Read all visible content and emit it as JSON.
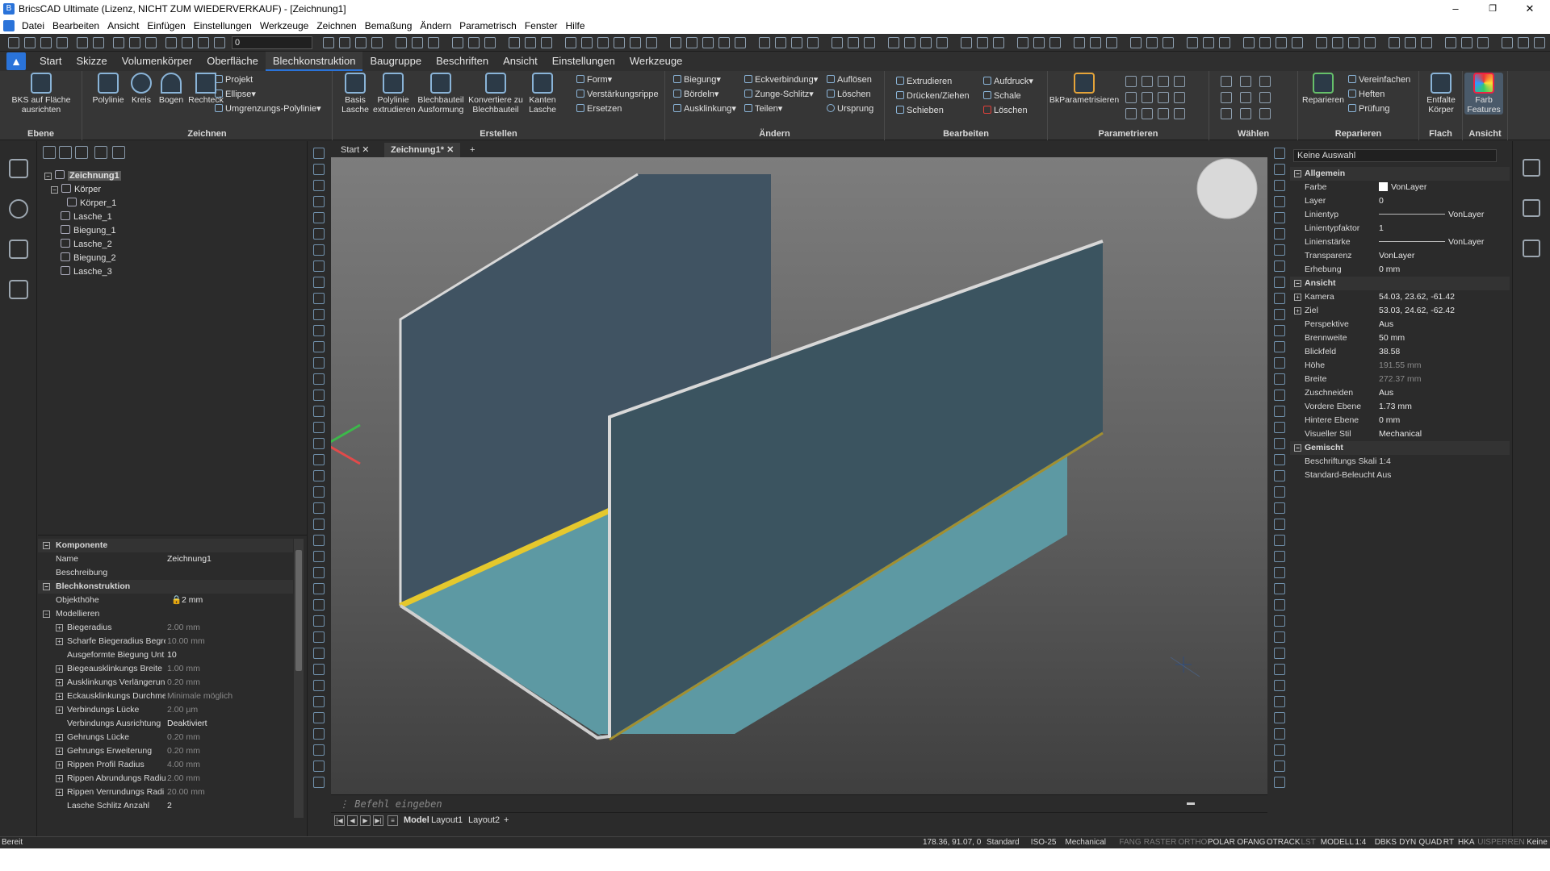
{
  "window": {
    "title": "BricsCAD Ultimate (Lizenz, NICHT ZUM WIEDERVERKAUF) - [Zeichnung1]",
    "minimize": "–",
    "maximize": "❐",
    "close": "✕"
  },
  "menu": [
    "Datei",
    "Bearbeiten",
    "Ansicht",
    "Einfügen",
    "Einstellungen",
    "Werkzeuge",
    "Zeichnen",
    "Bemaßung",
    "Ändern",
    "Parametrisch",
    "Fenster",
    "Hilfe"
  ],
  "qat": {
    "layer": "0"
  },
  "ribbon_tabs": [
    "Start",
    "Skizze",
    "Volumenkörper",
    "Oberfläche",
    "Blechkonstruktion",
    "Baugruppe",
    "Beschriften",
    "Ansicht",
    "Einstellungen",
    "Werkzeuge"
  ],
  "ribbon": {
    "ebene": {
      "title": "Ebene",
      "bks": "BKS auf Fläche ausrichten"
    },
    "zeichnen": {
      "title": "Zeichnen",
      "polylinie": "Polylinie",
      "kreis": "Kreis",
      "bogen": "Bogen",
      "rechteck": "Rechteck",
      "projekt": "Projekt",
      "ellipse": "Ellipse",
      "umgrenzung": "Umgrenzungs-Polylinie"
    },
    "erstellen": {
      "title": "Erstellen",
      "basis": "Basis Lasche",
      "polyextr": "Polylinie extrudieren",
      "blechform": "Blechbauteil Ausformung",
      "konvert": "Konvertiere zu Blechbauteil",
      "kanten": "Kanten Lasche",
      "form": "Form",
      "verst": "Verstärkungsrippe",
      "ersetzen": "Ersetzen"
    },
    "aendern": {
      "title": "Ändern",
      "biegung": "Biegung",
      "boerdeln": "Bördeln",
      "ausklinkung": "Ausklinkung",
      "eckverbindung": "Eckverbindung",
      "zunge": "Zunge-Schlitz",
      "teilen": "Teilen",
      "aufloesen": "Auflösen",
      "loeschen": "Löschen",
      "ursprung": "Ursprung"
    },
    "bearbeiten": {
      "title": "Bearbeiten",
      "extrudieren": "Extrudieren",
      "druecken": "Drücken/Ziehen",
      "schieben": "Schieben",
      "aufdruck": "Aufdruck",
      "schale": "Schale",
      "loeschen": "Löschen"
    },
    "parametrieren": {
      "title": "Parametrieren",
      "bkparam": "BkParametrisieren"
    },
    "waehlen": {
      "title": "Wählen"
    },
    "reparieren": {
      "title": "Reparieren",
      "reparieren": "Reparieren",
      "vereinfachen": "Vereinfachen",
      "heften": "Heften",
      "pruefung": "Prüfung"
    },
    "flach": {
      "title": "Flach",
      "entfalte": "Entfalte Körper"
    },
    "ansicht": {
      "title": "Ansicht",
      "farbfeatures": "Farb Features"
    }
  },
  "tree": {
    "root": "Zeichnung1",
    "koerper": "Körper",
    "items": [
      "Körper_1",
      "Lasche_1",
      "Biegung_1",
      "Lasche_2",
      "Biegung_2",
      "Lasche_3"
    ]
  },
  "props": {
    "komponente": "Komponente",
    "name_k": "Name",
    "name_v": "Zeichnung1",
    "beschreibung": "Beschreibung",
    "blech": "Blechkonstruktion",
    "objekthoehe_k": "Objekthöhe",
    "objekthoehe_v": "2 mm",
    "modellieren": "Modellieren",
    "rows": [
      {
        "k": "Biegeradius",
        "v": "2.00 mm"
      },
      {
        "k": "Scharfe Biegeradius Begre",
        "v": "10.00 mm"
      },
      {
        "k": "Ausgeformte Biegung Unt",
        "v": "10"
      },
      {
        "k": "Biegeausklinkungs Breite",
        "v": "1.00 mm"
      },
      {
        "k": "Ausklinkungs Verlängerun",
        "v": "0.20 mm"
      },
      {
        "k": "Eckausklinkungs Durchme",
        "v": "Minimale möglich"
      },
      {
        "k": "Verbindungs Lücke",
        "v": "2.00 µm"
      },
      {
        "k": "Verbindungs Ausrichtung",
        "v": "Deaktiviert"
      },
      {
        "k": "Gehrungs Lücke",
        "v": "0.20 mm"
      },
      {
        "k": "Gehrungs Erweiterung",
        "v": "0.20 mm"
      },
      {
        "k": "Rippen Profil Radius",
        "v": "4.00 mm"
      },
      {
        "k": "Rippen Abrundungs Radiu",
        "v": "2.00 mm"
      },
      {
        "k": "Rippen Verrundungs Radi",
        "v": "20.00 mm"
      },
      {
        "k": "Lasche Schlitz Anzahl",
        "v": "2"
      }
    ]
  },
  "doctabs": {
    "start": "Start",
    "drawing": "Zeichnung1*",
    "add": "+"
  },
  "cmdline": "Befehl eingeben",
  "layouts": {
    "model": "Model",
    "l1": "Layout1",
    "l2": "Layout2",
    "add": "+"
  },
  "rprops": {
    "selection": "Keine Auswahl",
    "allgemein": "Allgemein",
    "general": [
      {
        "k": "Farbe",
        "v": "VonLayer"
      },
      {
        "k": "Layer",
        "v": "0"
      },
      {
        "k": "Linientyp",
        "v": "VonLayer"
      },
      {
        "k": "Linientypfaktor",
        "v": "1"
      },
      {
        "k": "Linienstärke",
        "v": "VonLayer"
      },
      {
        "k": "Transparenz",
        "v": "VonLayer"
      },
      {
        "k": "Erhebung",
        "v": "0 mm"
      }
    ],
    "ansicht": "Ansicht",
    "view": [
      {
        "k": "Kamera",
        "v": "54.03, 23.62, -61.42"
      },
      {
        "k": "Ziel",
        "v": "53.03, 24.62, -62.42"
      },
      {
        "k": "Perspektive",
        "v": "Aus"
      },
      {
        "k": "Brennweite",
        "v": "50 mm"
      },
      {
        "k": "Blickfeld",
        "v": "38.58"
      },
      {
        "k": "Höhe",
        "v": "191.55 mm"
      },
      {
        "k": "Breite",
        "v": "272.37 mm"
      },
      {
        "k": "Zuschneiden",
        "v": "Aus"
      },
      {
        "k": "Vordere Ebene",
        "v": "1.73 mm"
      },
      {
        "k": "Hintere Ebene",
        "v": "0 mm"
      },
      {
        "k": "Visueller Stil",
        "v": "Mechanical"
      }
    ],
    "gemischt": "Gemischt",
    "mixed": [
      "Beschriftungs Skali 1:4",
      "Standard-Beleucht Aus"
    ]
  },
  "status": {
    "ready": "Bereit",
    "coords": "178.36, 91.07, 0",
    "items": [
      "Standard",
      "ISO-25",
      "Mechanical",
      "FANG",
      "RASTER",
      "ORTHO",
      "POLAR",
      "OFANG",
      "OTRACK",
      "LST",
      "MODELL",
      "1:4",
      "DBKS",
      "DYN",
      "QUAD",
      "RT",
      "HKA",
      "UISPERREN",
      "Keine"
    ],
    "off": [
      "FANG",
      "RASTER",
      "ORTHO",
      "LST",
      "UISPERREN"
    ]
  },
  "colors": {
    "accent": "#2a73d9",
    "floor": "#5d99a3",
    "wall": "#405868",
    "flange": "#e5c82d"
  }
}
